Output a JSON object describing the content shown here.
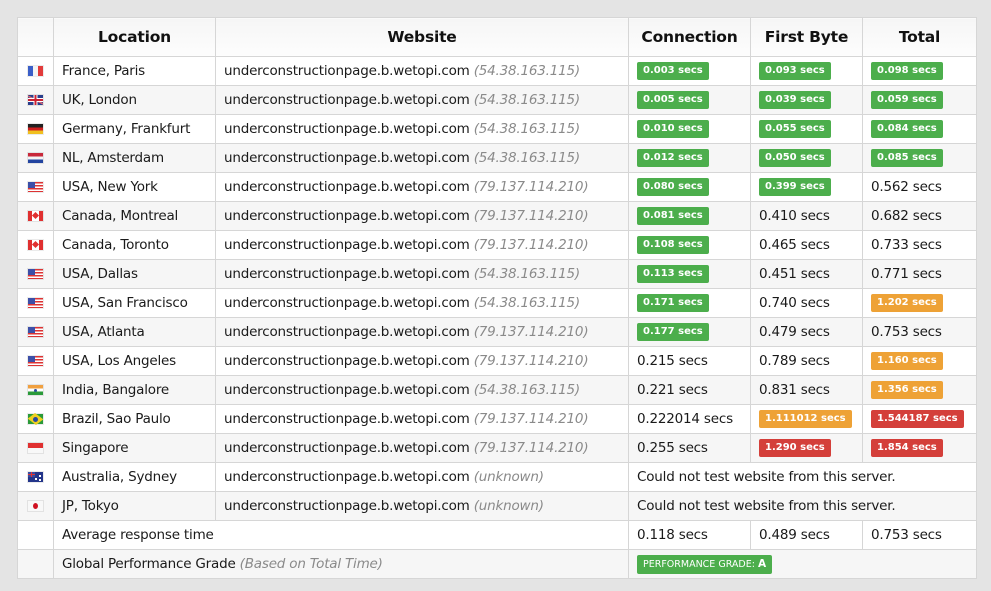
{
  "headers": {
    "flag": "",
    "location": "Location",
    "website": "Website",
    "connection": "Connection",
    "first_byte": "First Byte",
    "total": "Total"
  },
  "colors": {
    "good": "#4cae4c",
    "warn": "#eea236",
    "bad": "#d43f3a"
  },
  "rows": [
    {
      "flag": "france-flag-icon",
      "flag_class": "f-fr",
      "location": "France, Paris",
      "website": "underconstructionpage.b.wetopi.com",
      "ip": "(54.38.163.115)",
      "connection": {
        "value": "0.003 secs",
        "status": "good"
      },
      "first_byte": {
        "value": "0.093 secs",
        "status": "good"
      },
      "total": {
        "value": "0.098 secs",
        "status": "good"
      }
    },
    {
      "flag": "uk-flag-icon",
      "flag_class": "f-gb",
      "location": "UK, London",
      "website": "underconstructionpage.b.wetopi.com",
      "ip": "(54.38.163.115)",
      "connection": {
        "value": "0.005 secs",
        "status": "good"
      },
      "first_byte": {
        "value": "0.039 secs",
        "status": "good"
      },
      "total": {
        "value": "0.059 secs",
        "status": "good"
      }
    },
    {
      "flag": "germany-flag-icon",
      "flag_class": "f-de",
      "location": "Germany, Frankfurt",
      "website": "underconstructionpage.b.wetopi.com",
      "ip": "(54.38.163.115)",
      "connection": {
        "value": "0.010 secs",
        "status": "good"
      },
      "first_byte": {
        "value": "0.055 secs",
        "status": "good"
      },
      "total": {
        "value": "0.084 secs",
        "status": "good"
      }
    },
    {
      "flag": "netherlands-flag-icon",
      "flag_class": "f-nl",
      "location": "NL, Amsterdam",
      "website": "underconstructionpage.b.wetopi.com",
      "ip": "(54.38.163.115)",
      "connection": {
        "value": "0.012 secs",
        "status": "good"
      },
      "first_byte": {
        "value": "0.050 secs",
        "status": "good"
      },
      "total": {
        "value": "0.085 secs",
        "status": "good"
      }
    },
    {
      "flag": "usa-flag-icon",
      "flag_class": "f-us",
      "location": "USA, New York",
      "website": "underconstructionpage.b.wetopi.com",
      "ip": "(79.137.114.210)",
      "connection": {
        "value": "0.080 secs",
        "status": "good"
      },
      "first_byte": {
        "value": "0.399 secs",
        "status": "good"
      },
      "total": {
        "value": "0.562 secs",
        "status": "plain"
      }
    },
    {
      "flag": "canada-flag-icon",
      "flag_class": "f-ca",
      "location": "Canada, Montreal",
      "website": "underconstructionpage.b.wetopi.com",
      "ip": "(79.137.114.210)",
      "connection": {
        "value": "0.081 secs",
        "status": "good"
      },
      "first_byte": {
        "value": "0.410 secs",
        "status": "plain"
      },
      "total": {
        "value": "0.682 secs",
        "status": "plain"
      }
    },
    {
      "flag": "canada-flag-icon",
      "flag_class": "f-ca",
      "location": "Canada, Toronto",
      "website": "underconstructionpage.b.wetopi.com",
      "ip": "(79.137.114.210)",
      "connection": {
        "value": "0.108 secs",
        "status": "good"
      },
      "first_byte": {
        "value": "0.465 secs",
        "status": "plain"
      },
      "total": {
        "value": "0.733 secs",
        "status": "plain"
      }
    },
    {
      "flag": "usa-flag-icon",
      "flag_class": "f-us",
      "location": "USA, Dallas",
      "website": "underconstructionpage.b.wetopi.com",
      "ip": "(54.38.163.115)",
      "connection": {
        "value": "0.113 secs",
        "status": "good"
      },
      "first_byte": {
        "value": "0.451 secs",
        "status": "plain"
      },
      "total": {
        "value": "0.771 secs",
        "status": "plain"
      }
    },
    {
      "flag": "usa-flag-icon",
      "flag_class": "f-us",
      "location": "USA, San Francisco",
      "website": "underconstructionpage.b.wetopi.com",
      "ip": "(54.38.163.115)",
      "connection": {
        "value": "0.171 secs",
        "status": "good"
      },
      "first_byte": {
        "value": "0.740 secs",
        "status": "plain"
      },
      "total": {
        "value": "1.202 secs",
        "status": "warn"
      }
    },
    {
      "flag": "usa-flag-icon",
      "flag_class": "f-us",
      "location": "USA, Atlanta",
      "website": "underconstructionpage.b.wetopi.com",
      "ip": "(79.137.114.210)",
      "connection": {
        "value": "0.177 secs",
        "status": "good"
      },
      "first_byte": {
        "value": "0.479 secs",
        "status": "plain"
      },
      "total": {
        "value": "0.753 secs",
        "status": "plain"
      }
    },
    {
      "flag": "usa-flag-icon",
      "flag_class": "f-us",
      "location": "USA, Los Angeles",
      "website": "underconstructionpage.b.wetopi.com",
      "ip": "(79.137.114.210)",
      "connection": {
        "value": "0.215 secs",
        "status": "plain"
      },
      "first_byte": {
        "value": "0.789 secs",
        "status": "plain"
      },
      "total": {
        "value": "1.160 secs",
        "status": "warn"
      }
    },
    {
      "flag": "india-flag-icon",
      "flag_class": "f-in",
      "location": "India, Bangalore",
      "website": "underconstructionpage.b.wetopi.com",
      "ip": "(54.38.163.115)",
      "connection": {
        "value": "0.221 secs",
        "status": "plain"
      },
      "first_byte": {
        "value": "0.831 secs",
        "status": "plain"
      },
      "total": {
        "value": "1.356 secs",
        "status": "warn"
      }
    },
    {
      "flag": "brazil-flag-icon",
      "flag_class": "f-br",
      "location": "Brazil, Sao Paulo",
      "website": "underconstructionpage.b.wetopi.com",
      "ip": "(79.137.114.210)",
      "connection": {
        "value": "0.222014 secs",
        "status": "plain"
      },
      "first_byte": {
        "value": "1.111012 secs",
        "status": "warn"
      },
      "total": {
        "value": "1.544187 secs",
        "status": "bad"
      }
    },
    {
      "flag": "singapore-flag-icon",
      "flag_class": "f-sg",
      "location": "Singapore",
      "website": "underconstructionpage.b.wetopi.com",
      "ip": "(79.137.114.210)",
      "connection": {
        "value": "0.255 secs",
        "status": "plain"
      },
      "first_byte": {
        "value": "1.290 secs",
        "status": "bad"
      },
      "total": {
        "value": "1.854 secs",
        "status": "bad"
      }
    },
    {
      "flag": "australia-flag-icon",
      "flag_class": "f-au",
      "location": "Australia, Sydney",
      "website": "underconstructionpage.b.wetopi.com",
      "ip": "(unknown)",
      "error": "Could not test website from this server."
    },
    {
      "flag": "japan-flag-icon",
      "flag_class": "f-jp",
      "location": "JP, Tokyo",
      "website": "underconstructionpage.b.wetopi.com",
      "ip": "(unknown)",
      "error": "Could not test website from this server."
    }
  ],
  "average": {
    "label": "Average response time",
    "connection": "0.118 secs",
    "first_byte": "0.489 secs",
    "total": "0.753 secs"
  },
  "grade": {
    "label": "Global Performance Grade",
    "note": "(Based on Total Time)",
    "badge_label": "PERFORMANCE GRADE:",
    "badge_value": "A"
  }
}
